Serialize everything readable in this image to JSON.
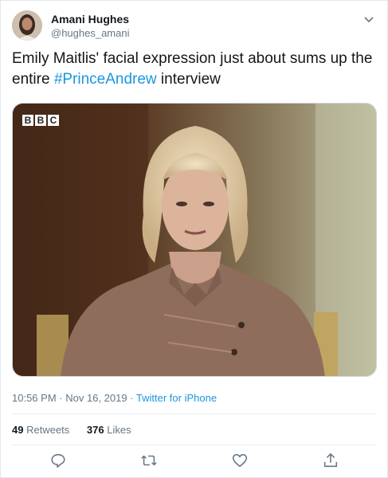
{
  "author": {
    "display_name": "Amani Hughes",
    "handle": "@hughes_amani"
  },
  "tweet": {
    "text_before": "Emily Maitlis' facial expression just about sums up the entire ",
    "hashtag": "#PrinceAndrew",
    "text_after": " interview"
  },
  "media": {
    "watermark": "BBC"
  },
  "meta": {
    "time": "10:56 PM",
    "separator1": " · ",
    "date": "Nov 16, 2019",
    "separator2": " · ",
    "source": "Twitter for iPhone"
  },
  "stats": {
    "retweets_count": "49",
    "retweets_label": "Retweets",
    "likes_count": "376",
    "likes_label": "Likes"
  },
  "actions": {
    "reply": "reply-icon",
    "retweet": "retweet-icon",
    "like": "heart-icon",
    "share": "share-icon"
  },
  "colors": {
    "link": "#1b95e0",
    "secondary_text": "#657786",
    "primary_text": "#14171a"
  }
}
